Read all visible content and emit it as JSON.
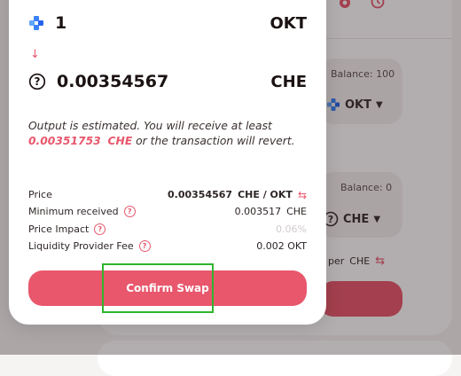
{
  "background": {
    "from_panel": {
      "balance": "Balance: 100",
      "token": "OKT"
    },
    "to_panel": {
      "balance": "Balance: 0",
      "token": "CHE"
    },
    "rate": {
      "text": "per",
      "token": "CHE"
    },
    "icons": [
      "gear-icon",
      "history-icon",
      "okt-token-icon",
      "question-token-icon",
      "swap-arrows-icon"
    ]
  },
  "modal": {
    "input": {
      "amount": "1",
      "token": "OKT",
      "icon": "okt-token-icon"
    },
    "output": {
      "amount": "0.00354567",
      "token": "CHE",
      "icon": "question-token-icon"
    },
    "estimate": {
      "line1": "Output is estimated. You will receive at least",
      "min_amount": "0.00351753",
      "min_token": "CHE",
      "line2": "or the transaction will revert."
    },
    "details": {
      "price": {
        "label": "Price",
        "value": "0.00354567",
        "unit": "CHE / OKT"
      },
      "minimum_received": {
        "label": "Minimum received",
        "value": "0.003517",
        "unit": "CHE"
      },
      "price_impact": {
        "label": "Price Impact",
        "value": "0.06%"
      },
      "lp_fee": {
        "label": "Liquidity Provider Fee",
        "value": "0.002 OKT"
      }
    },
    "confirm_label": "Confirm Swap"
  },
  "colors": {
    "accent": "#e8576c",
    "highlight": "#2fb52f",
    "okt_blue": "#3b82f6"
  }
}
